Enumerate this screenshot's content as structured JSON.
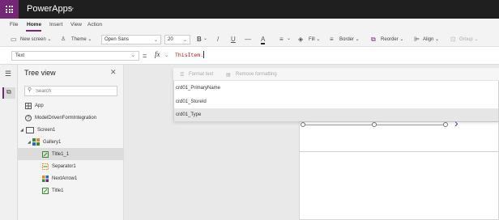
{
  "app": {
    "title": "PowerApps"
  },
  "ribbon_tabs": [
    "File",
    "Home",
    "Insert",
    "View",
    "Action"
  ],
  "active_tab": "Home",
  "ribbon": {
    "new_screen": "New screen",
    "theme": "Theme",
    "font": "Open Sans",
    "font_size": "20",
    "bold": "B",
    "italic": "/",
    "underline": "U",
    "strike": "—",
    "font_color": "A",
    "fill": "Fill",
    "border": "Border",
    "reorder": "Reorder",
    "align": "Align",
    "group": "Group"
  },
  "formula_bar": {
    "property": "Text",
    "equals": "=",
    "fx": "fx",
    "formula": "ThisItem."
  },
  "tree_view": {
    "title": "Tree view",
    "search_placeholder": "Search",
    "nodes": [
      {
        "label": "App",
        "icon": "app-icon"
      },
      {
        "label": "ModelDrivenFormIntegration",
        "icon": "help-circle-icon"
      },
      {
        "label": "Screen1",
        "icon": "screen-icon"
      },
      {
        "label": "Gallery1",
        "icon": "gallery-icon"
      },
      {
        "label": "Title1_1",
        "icon": "edit-label-icon"
      },
      {
        "label": "Separator1",
        "icon": "separator-icon"
      },
      {
        "label": "NextArrow1",
        "icon": "next-arrow-icon"
      },
      {
        "label": "Title1",
        "icon": "edit-label-icon"
      }
    ]
  },
  "suggest": {
    "toolbar": {
      "format_text": "Format text",
      "remove_formatting": "Remove formatting"
    },
    "items": [
      "crd01_PrimaryName",
      "crd01_StoreId",
      "crd01_Type"
    ]
  },
  "colors": {
    "brand": "#742774",
    "appbar": "#1f1f1f",
    "formula_text": "#a31515",
    "arrow": "#4a3d8a"
  }
}
